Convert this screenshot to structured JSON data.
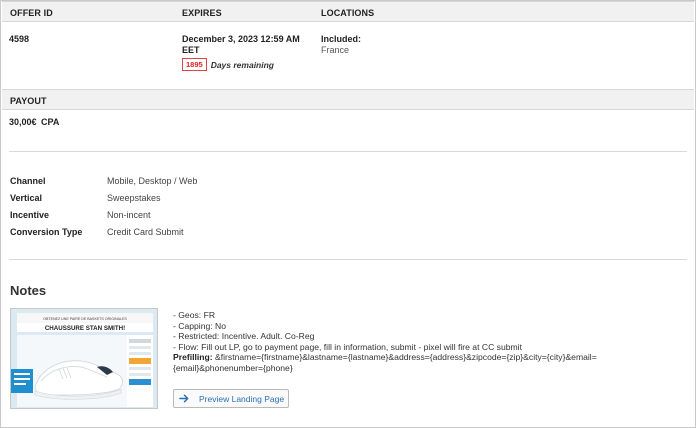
{
  "headers": {
    "offer_id": "OFFER ID",
    "expires": "EXPIRES",
    "locations": "LOCATIONS",
    "payout": "PAYOUT"
  },
  "offer": {
    "id": "4598",
    "expires_line1": "December 3, 2023 12:59 AM",
    "expires_line2": "EET",
    "days_count": "1895",
    "days_label": "Days remaining",
    "locations_label": "Included:",
    "locations_value": "France",
    "payout_value": "30,00€",
    "payout_type": "CPA"
  },
  "attributes": [
    {
      "label": "Channel",
      "value": "Mobile, Desktop / Web"
    },
    {
      "label": "Vertical",
      "value": "Sweepstakes"
    },
    {
      "label": "Incentive",
      "value": "Non-incent"
    },
    {
      "label": "Conversion Type",
      "value": "Credit Card Submit"
    }
  ],
  "notes": {
    "title": "Notes",
    "lines": [
      "- Geos: FR",
      "- Capping: No",
      "- Restricted: Incentive. Adult. Co-Reg",
      "- Flow: Fill out LP, go to payment page, fill in information, submit - pixel will fire at CC submit"
    ],
    "prefill_label": "Prefilling:",
    "prefill_value_1": " &firstname={firstname}&lastname={lastname}&address={address}&zipcode={zip}&city={city}&email=",
    "prefill_value_2": "{email}&phonenumber={phone}",
    "preview_button": "Preview Landing Page"
  },
  "thumbnail": {
    "small_text": "OBTENEZ UNE PAIRE DE BASKETS ORIGINALES",
    "headline": "CHAUSSURE STAN SMITH!",
    "product": "sneaker-image"
  },
  "colors": {
    "header_bg": "#f1f1f1",
    "badge_red": "#d22222",
    "link_blue": "#2a6fb5",
    "thumb_blue": "#1f8fd0"
  }
}
